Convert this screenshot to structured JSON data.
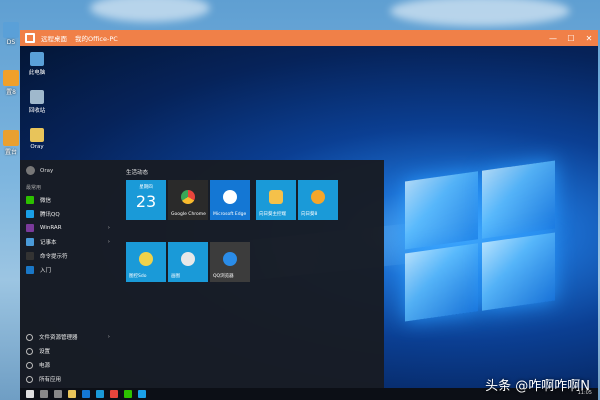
{
  "host": {
    "icons": [
      {
        "icon": "folder-icon",
        "label": "DS",
        "color": "#5aa0d8"
      },
      {
        "icon": "gear-icon",
        "label": "置8",
        "color": "#f0a02a"
      },
      {
        "icon": "package-icon",
        "label": "置台",
        "color": "#e9a030"
      }
    ]
  },
  "window": {
    "title": "远程桌面",
    "subtitle": "我的Office-PC",
    "controls": {
      "minimize": "—",
      "maximize": "☐",
      "close": "✕"
    },
    "drop": "⌄",
    "accent": "#f08048"
  },
  "desktop_icons": [
    {
      "icon": "computer-icon",
      "label": "此电脑",
      "color": "#5aa0d8"
    },
    {
      "icon": "recycle-bin-icon",
      "label": "回收站",
      "color": "#9fb8cc"
    },
    {
      "icon": "folder-icon",
      "label": "Oray",
      "color": "#e8c45a"
    }
  ],
  "start_menu": {
    "user": "Oray",
    "section_label": "最常用",
    "items": [
      {
        "icon": "wechat-icon",
        "label": "微信",
        "color": "#2dc100",
        "chevron": ""
      },
      {
        "icon": "qq-icon",
        "label": "腾讯QQ",
        "color": "#1aa0e8",
        "chevron": ""
      },
      {
        "icon": "winrar-icon",
        "label": "WinRAR",
        "color": "#7a3a9a",
        "chevron": "›"
      },
      {
        "icon": "notepad-icon",
        "label": "记事本",
        "color": "#4a9ad8",
        "chevron": "›"
      },
      {
        "icon": "cmd-icon",
        "label": "命令提示符",
        "color": "#333333",
        "chevron": ""
      },
      {
        "icon": "person-icon",
        "label": "入门",
        "color": "#1a78c8",
        "chevron": ""
      }
    ],
    "system_items": [
      {
        "icon": "file-explorer-icon",
        "label": "文件资源管理器",
        "chevron": "›"
      },
      {
        "icon": "gear-icon",
        "label": "设置",
        "chevron": ""
      },
      {
        "icon": "power-icon",
        "label": "电源",
        "chevron": ""
      },
      {
        "icon": "apps-icon",
        "label": "所有应用",
        "chevron": ""
      }
    ],
    "group_title": "生活动态",
    "calendar": {
      "day": "星期四",
      "date": "23"
    },
    "tiles": [
      {
        "icon": "chrome-icon",
        "label": "Google Chrome",
        "color": "#2a2a2a"
      },
      {
        "icon": "edge-icon",
        "label": "Microsoft Edge",
        "color": "#1477d4"
      },
      {
        "icon": "folder-icon",
        "label": "向日葵主控端",
        "color": "#1a9ad8"
      },
      {
        "icon": "sunflower-icon",
        "label": "向日葵8",
        "color": "#1a9ad8"
      }
    ],
    "tiles_row2": [
      {
        "icon": "flower-icon",
        "label": "图控Sdo",
        "color": "#1a9ad8"
      },
      {
        "icon": "paint-icon",
        "label": "画图",
        "color": "#1a9ad8"
      },
      {
        "icon": "qq-browser-icon",
        "label": "QQ浏览器",
        "color": "#3c3c3c"
      }
    ]
  },
  "taskbar": {
    "clock": "11:05",
    "items": [
      {
        "icon": "windows-start-icon",
        "color": "#dddddd"
      },
      {
        "icon": "search-icon",
        "color": "#888888"
      },
      {
        "icon": "task-view-icon",
        "color": "#888888"
      },
      {
        "icon": "explorer-icon",
        "color": "#e8c45a"
      },
      {
        "icon": "edge-icon",
        "color": "#1477d4"
      },
      {
        "icon": "store-icon",
        "color": "#1a9ad8"
      },
      {
        "icon": "chrome-icon",
        "color": "#e8453c"
      },
      {
        "icon": "wechat-icon",
        "color": "#2dc100"
      },
      {
        "icon": "qq-icon",
        "color": "#1aa0e8"
      }
    ]
  },
  "watermark": "头条 @咋啊咋啊N"
}
